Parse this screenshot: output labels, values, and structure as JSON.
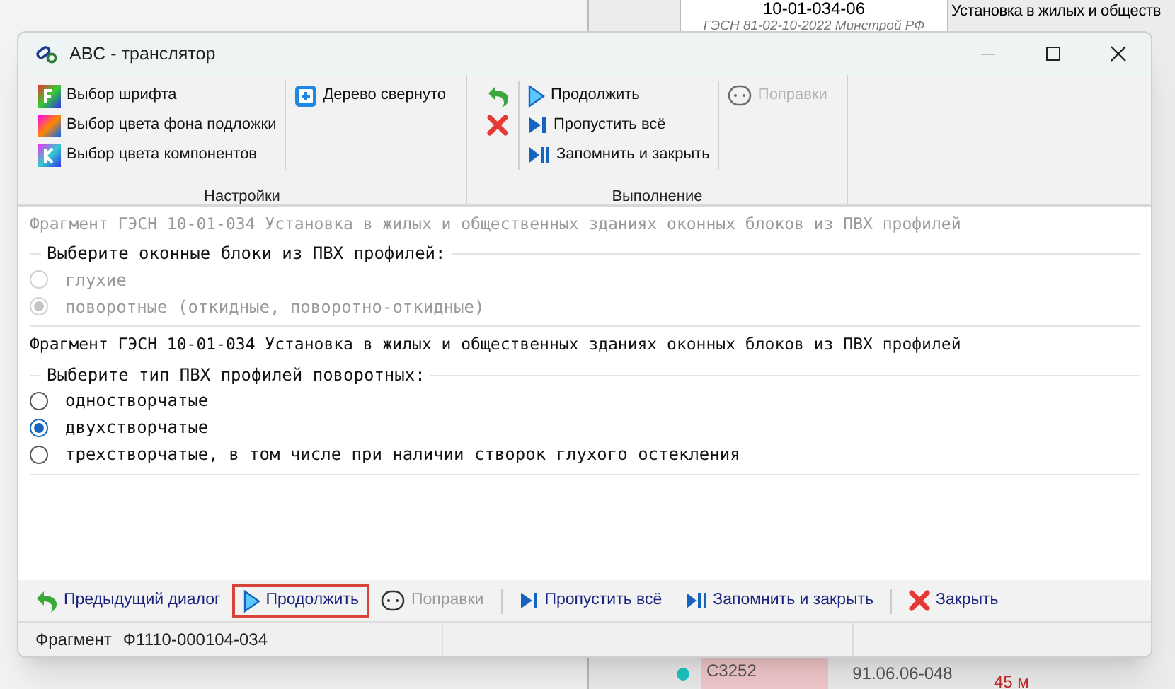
{
  "background": {
    "top_row": {
      "code": "10-01-034-06",
      "source": "ГЭСН 81-02-10-2022 Минстрой РФ",
      "description": "Установка в жилых и обществ"
    },
    "bottom_row": {
      "color": "#1fc7c7",
      "code": "С3252",
      "resource": "91.06.06-048",
      "amount": "45 м"
    }
  },
  "window": {
    "title": "ABC - транслятор"
  },
  "ribbon": {
    "groups": [
      {
        "label": "Настройки",
        "columns": [
          [
            {
              "kind": "font",
              "label": "Выбор шрифта",
              "disabled": false
            },
            {
              "kind": "palette",
              "label": "Выбор цвета фона подложки",
              "disabled": false
            },
            {
              "kind": "palette-k",
              "label": "Выбор цвета компонентов",
              "disabled": false
            }
          ],
          [
            {
              "kind": "tree",
              "label": "Дерево свернуто",
              "disabled": false
            }
          ]
        ]
      },
      {
        "label": "Выполнение",
        "columns": [
          [
            {
              "kind": "back",
              "disabled": false
            },
            {
              "kind": "close",
              "disabled": false
            }
          ],
          [
            {
              "kind": "play",
              "label": "Продолжить",
              "disabled": false
            },
            {
              "kind": "skip",
              "label": "Пропустить всё",
              "disabled": false
            },
            {
              "kind": "save",
              "label": "Запомнить и закрыть",
              "disabled": false
            }
          ],
          [
            {
              "kind": "corrections",
              "label": "Поправки",
              "disabled": true
            }
          ]
        ]
      }
    ]
  },
  "fragments": [
    {
      "title": "Фрагмент ГЭСН 10-01-034 Установка в жилых и общественных зданиях оконных блоков из ПВХ профилей",
      "question": "Выберите оконные блоки из ПВХ профилей:",
      "disabled": true,
      "options": [
        {
          "label": "глухие",
          "selected": false
        },
        {
          "label": "поворотные (откидные, поворотно-откидные)",
          "selected": true
        }
      ]
    },
    {
      "title": "Фрагмент ГЭСН 10-01-034 Установка в жилых и общественных зданиях оконных блоков из ПВХ профилей",
      "question": "Выберите тип ПВХ профилей поворотных:",
      "disabled": false,
      "options": [
        {
          "label": "одностворчатые",
          "selected": false
        },
        {
          "label": "двухстворчатые",
          "selected": true
        },
        {
          "label": "трехстворчатые, в том числе при наличии створок глухого остекления",
          "selected": false
        }
      ]
    }
  ],
  "toolbar": [
    {
      "kind": "back",
      "label": "Предыдущий диалог",
      "disabled": false,
      "focused": false
    },
    {
      "kind": "play",
      "label": "Продолжить",
      "disabled": false,
      "focused": true
    },
    {
      "kind": "corrections",
      "label": "Поправки",
      "disabled": true,
      "focused": false
    },
    {
      "kind": "skip",
      "label": "Пропустить всё",
      "disabled": false,
      "focused": false
    },
    {
      "kind": "save",
      "label": "Запомнить и закрыть",
      "disabled": false,
      "focused": false
    },
    {
      "kind": "close",
      "label": "Закрыть",
      "disabled": false,
      "focused": false
    }
  ],
  "status_bar": {
    "label": "Фрагмент",
    "value": "Ф1110-000104-034"
  }
}
